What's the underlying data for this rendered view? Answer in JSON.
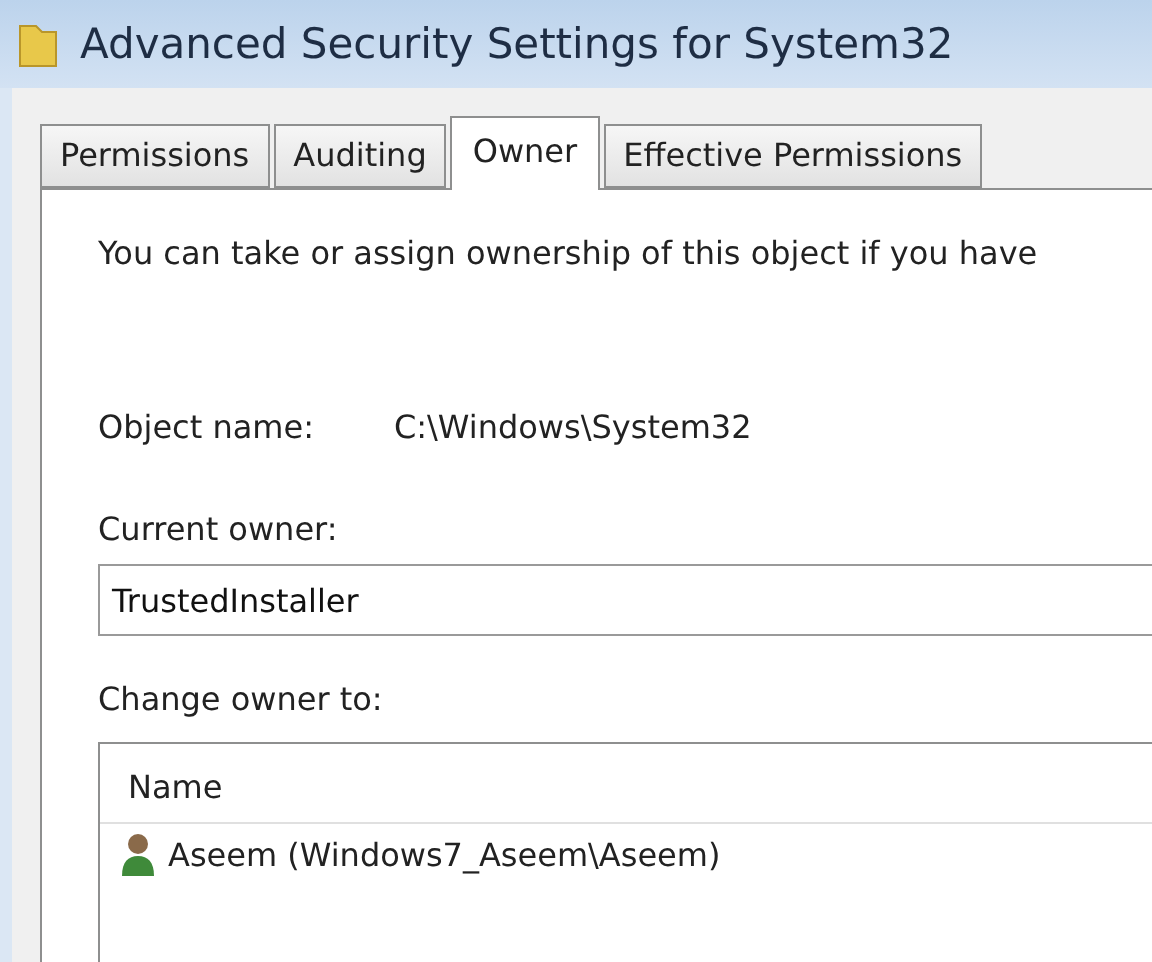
{
  "window": {
    "title": "Advanced Security Settings for System32"
  },
  "tabs": [
    {
      "label": "Permissions",
      "selected": false
    },
    {
      "label": "Auditing",
      "selected": false
    },
    {
      "label": "Owner",
      "selected": true
    },
    {
      "label": "Effective Permissions",
      "selected": false
    }
  ],
  "intro": "You can take or assign ownership of this object if you have",
  "object_name": {
    "label": "Object name:",
    "value": "C:\\Windows\\System32"
  },
  "current_owner": {
    "label": "Current owner:",
    "value": "TrustedInstaller"
  },
  "change_owner": {
    "label": "Change owner to:",
    "columns": [
      "Name"
    ],
    "rows": [
      {
        "name": "Aseem (Windows7_Aseem\\Aseem)",
        "selected": false
      }
    ]
  }
}
